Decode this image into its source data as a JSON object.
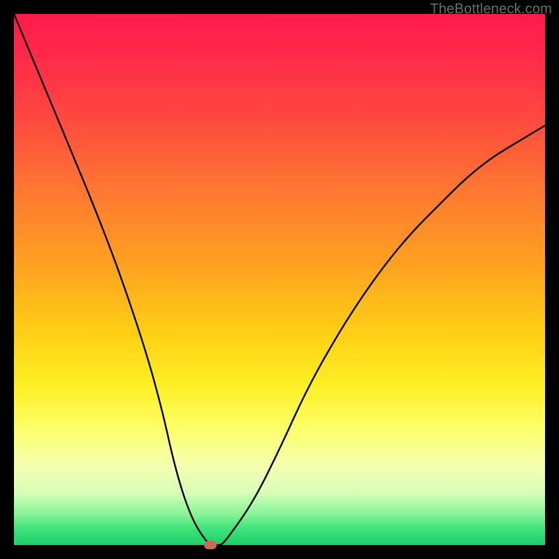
{
  "watermark": "TheBottleneck.com",
  "chart_data": {
    "type": "line",
    "title": "",
    "xlabel": "",
    "ylabel": "",
    "xlim": [
      0,
      100
    ],
    "ylim": [
      0,
      100
    ],
    "grid": false,
    "series": [
      {
        "name": "bottleneck-curve",
        "x": [
          0,
          5,
          10,
          15,
          20,
          25,
          28,
          30,
          32,
          34,
          36,
          37,
          38,
          39,
          40,
          45,
          50,
          55,
          60,
          65,
          70,
          75,
          80,
          85,
          90,
          95,
          100
        ],
        "y": [
          100,
          88,
          76,
          64,
          51,
          36,
          25,
          16,
          9,
          4,
          1,
          0,
          0,
          0,
          1,
          8,
          18,
          29,
          38,
          46,
          53,
          59,
          64,
          69,
          73,
          76,
          79
        ]
      }
    ],
    "annotations": [
      {
        "name": "optimum-marker",
        "x": 37,
        "y": 0
      }
    ],
    "background_gradient": {
      "top": "#ff1a4d",
      "bottom": "#1cd06a",
      "meaning": "red=high bottleneck, green=balanced"
    }
  }
}
